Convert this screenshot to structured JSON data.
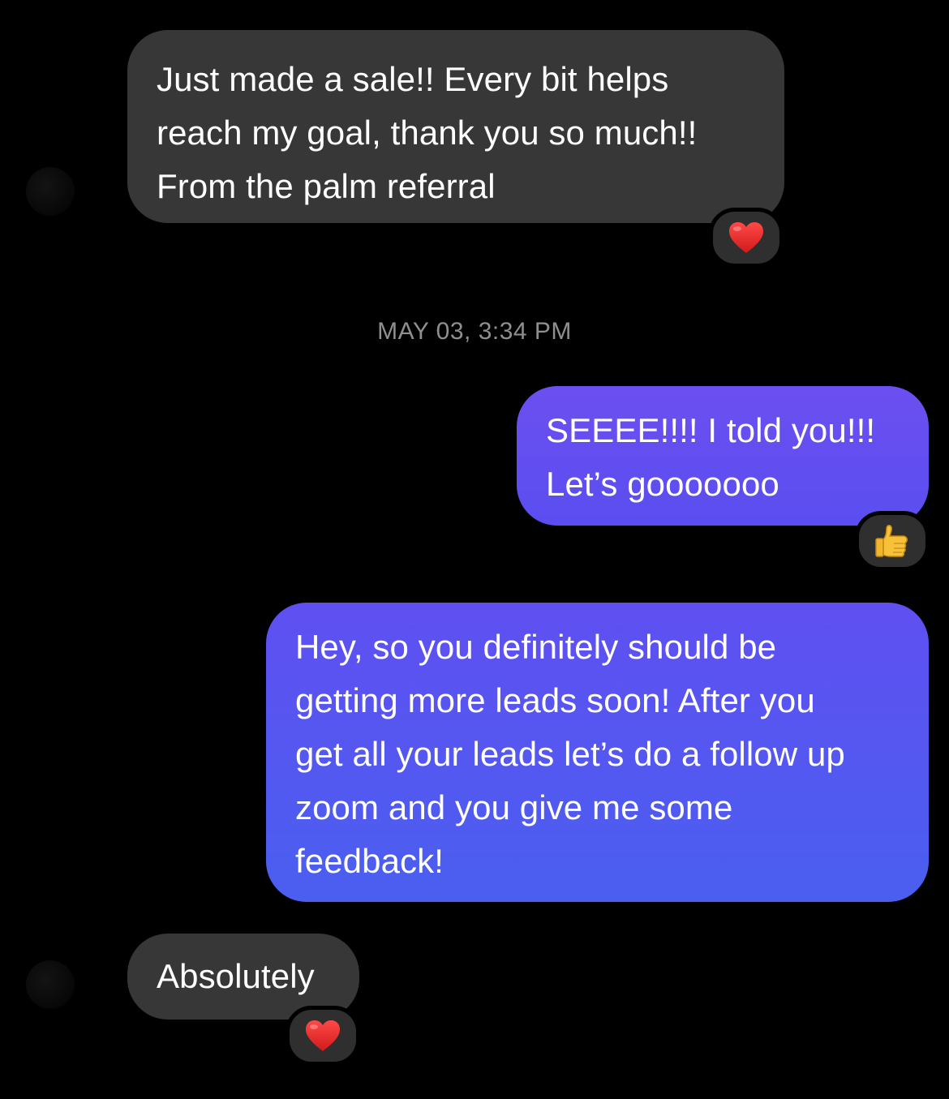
{
  "conversation": {
    "messages": [
      {
        "sender": "contact",
        "lines": [
          "Just made a sale!! Every bit helps",
          "reach my goal, thank you so much!!",
          "From the palm referral"
        ],
        "reaction": "red-heart"
      },
      {
        "sender": "me",
        "lines": [
          "SEEEE!!!! I told you!!!",
          "Let’s gooooooo"
        ],
        "reaction": "thumbs-up"
      },
      {
        "sender": "me",
        "lines": [
          "Hey, so you definitely should be",
          "getting more leads soon! After you",
          "get all your leads let’s do a follow up",
          "zoom and you give me some",
          "feedback!"
        ]
      },
      {
        "sender": "contact",
        "lines": [
          "Absolutely"
        ],
        "reaction": "red-heart"
      }
    ],
    "timestamp": "MAY 03, 3:34 PM"
  },
  "colors": {
    "background": "#000000",
    "incoming_bubble": "#373737",
    "outgoing_bubble_top": "#6c4ff0",
    "outgoing_bubble_bottom": "#4a5ff0",
    "timestamp": "#8f8f8f"
  }
}
